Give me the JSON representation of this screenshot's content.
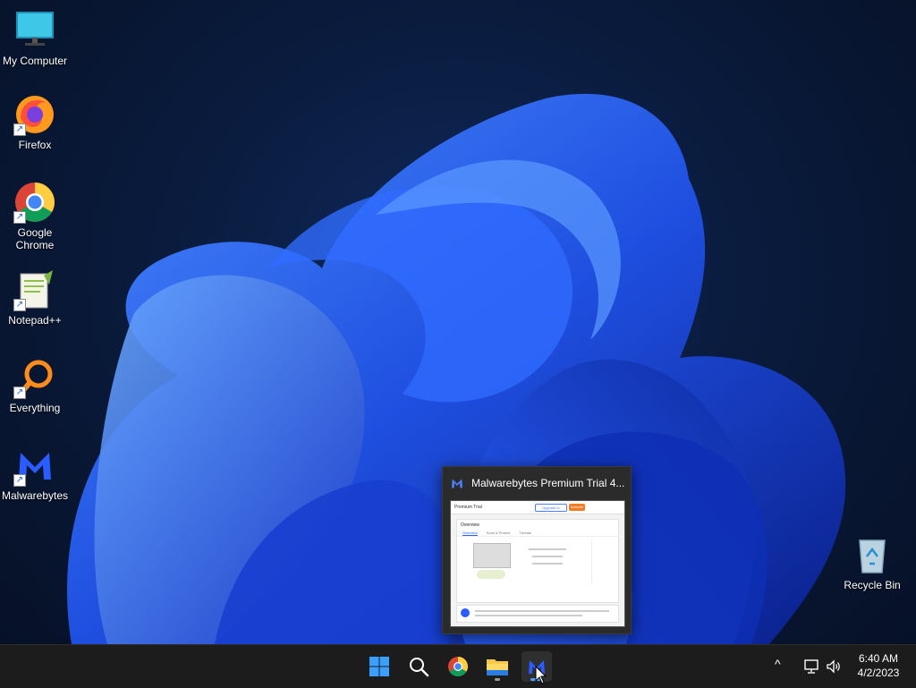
{
  "desktop": {
    "icons": [
      {
        "label": "My Computer",
        "icon": "monitor-icon"
      },
      {
        "label": "Firefox",
        "icon": "firefox-icon"
      },
      {
        "label": "Google Chrome",
        "icon": "chrome-icon"
      },
      {
        "label": "Notepad++",
        "icon": "notepadpp-icon"
      },
      {
        "label": "Everything",
        "icon": "everything-search-icon"
      },
      {
        "label": "Malwarebytes",
        "icon": "malwarebytes-icon"
      },
      {
        "label": "Recycle Bin",
        "icon": "recycle-bin-icon"
      }
    ]
  },
  "taskbar": {
    "apps": [
      {
        "name": "Start",
        "icon": "windows-start-icon"
      },
      {
        "name": "Search",
        "icon": "search-icon"
      },
      {
        "name": "Google Chrome",
        "icon": "chrome-icon"
      },
      {
        "name": "File Explorer",
        "icon": "folder-icon"
      },
      {
        "name": "Malwarebytes",
        "icon": "malwarebytes-icon"
      }
    ],
    "tray": {
      "chevron": "^",
      "time": "6:40 AM",
      "date": "4/2/2023"
    }
  },
  "preview": {
    "title": "Malwarebytes Premium Trial  4...",
    "thumb": {
      "header": "Premium Trial",
      "button_left": "Upgrade to Premium",
      "button_right": "Activate",
      "card_title": "Overview",
      "tabs": [
        "Overview",
        "Scan & Protect",
        "Threats"
      ]
    }
  },
  "colors": {
    "accent": "#1e5bff",
    "taskbar_bg": "#1c1c1c",
    "malwarebytes_blue": "#2a5cff"
  }
}
